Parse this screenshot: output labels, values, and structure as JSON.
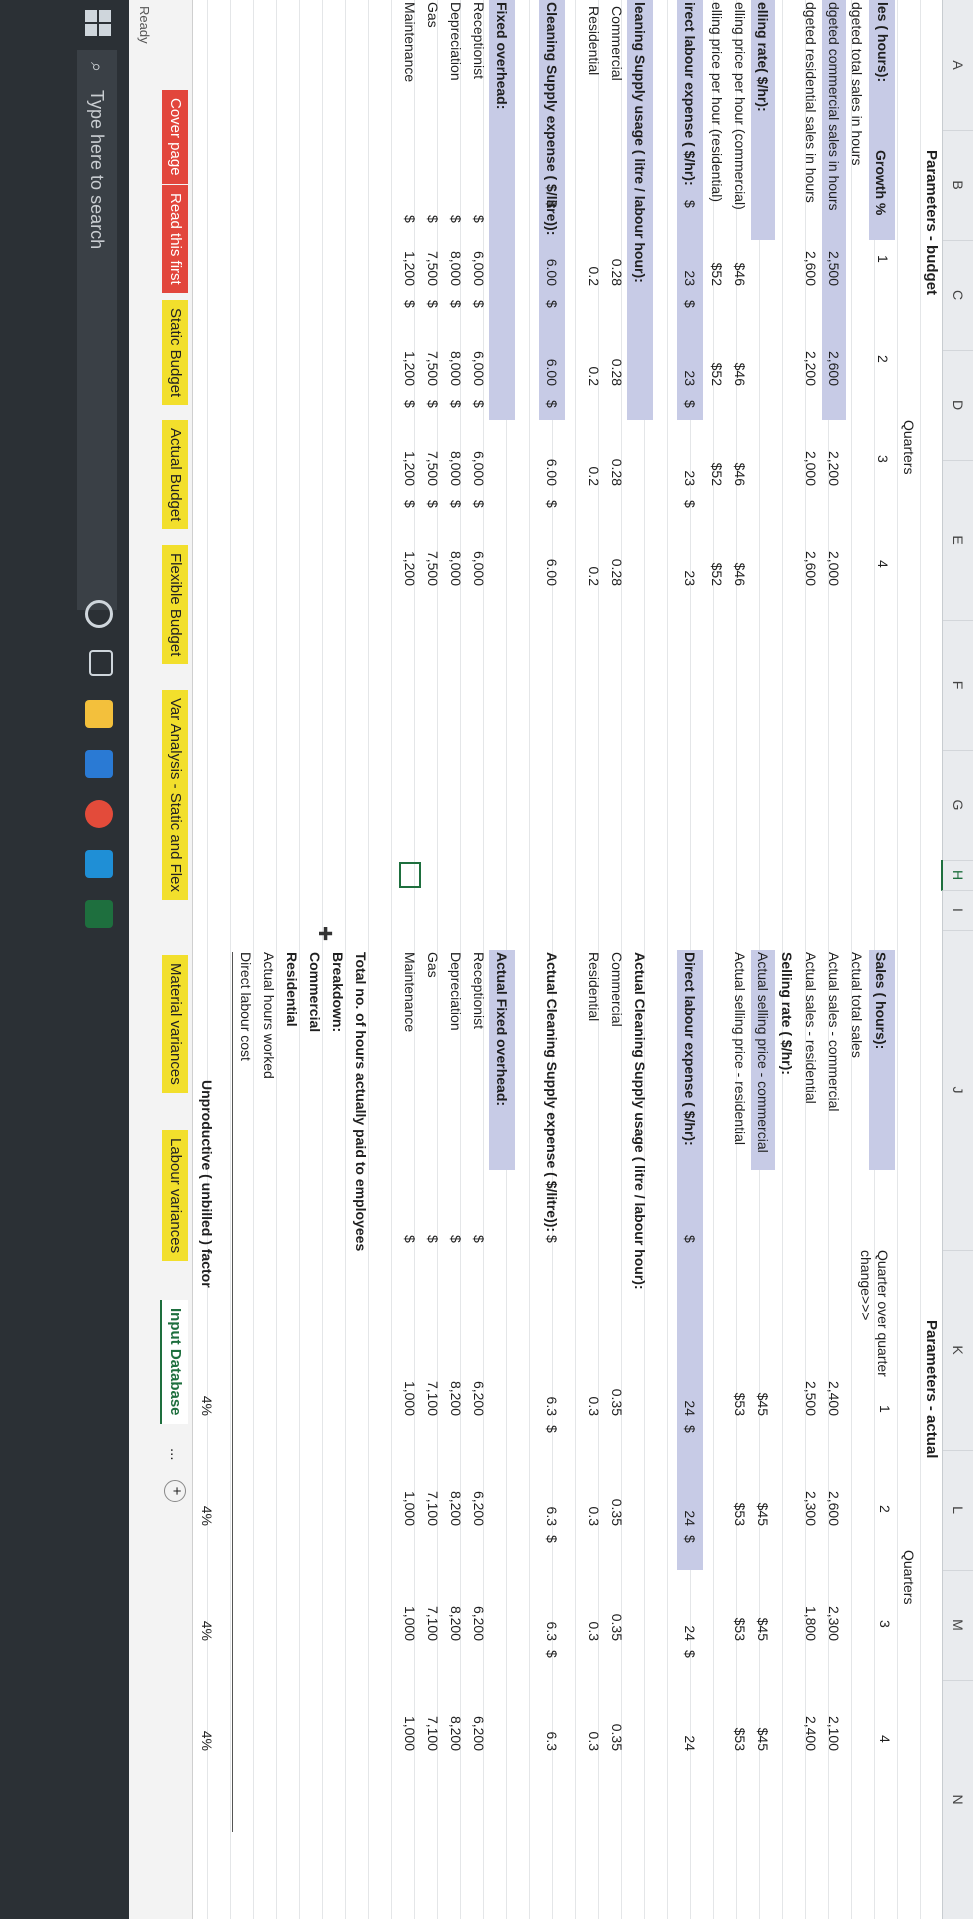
{
  "columns": [
    "A",
    "B",
    "C",
    "D",
    "E",
    "F",
    "G",
    "H",
    "I",
    "J",
    "K",
    "L",
    "M",
    "N"
  ],
  "budget": {
    "title": "Parameters - budget",
    "quarters_label": "Quarters",
    "quarters": [
      "1",
      "2",
      "3",
      "4"
    ],
    "growth_label": "Growth %",
    "rows": {
      "sales": "les ( hours):",
      "total": "dgeted total sales in hours",
      "comm": "dgeted commercial sales in hours",
      "res": "dgeted residential sales in hours",
      "rate": "elling rate( $/hr):",
      "rate_c": "elling price per hour (commercial)",
      "rate_r": "elling price per hour (residential)",
      "dl": "irect labour expense ( $/hr):",
      "csu": "leaning Supply usage ( litre / labour hour):",
      "csu_c": "Commercial",
      "csu_r": "Residential",
      "cse": "Cleaning Supply expense ( $/litre)):",
      "fo": "Fixed overhead:",
      "fo1": "Receptionist",
      "fo2": "Depreciation",
      "fo3": "Gas",
      "fo4": "Maintenance"
    },
    "comm": [
      "2,500",
      "2,600",
      "2,200",
      "2,000"
    ],
    "res": [
      "2,600",
      "2,200",
      "2,000",
      "2,600"
    ],
    "rate_c": [
      "$46",
      "$46",
      "$46",
      "$46"
    ],
    "rate_r": [
      "$52",
      "$52",
      "$52",
      "$52"
    ],
    "dl_cur": "$",
    "dl": [
      "23",
      "23",
      "23",
      "23"
    ],
    "csu_c": [
      "0.28",
      "0.28",
      "0.28",
      "0.28"
    ],
    "csu_r": [
      "0.2",
      "0.2",
      "0.2",
      "0.2"
    ],
    "cse": [
      "6.00",
      "6.00",
      "6.00",
      "6.00"
    ],
    "fo1": [
      "6,000",
      "6,000",
      "6,000",
      "6,000"
    ],
    "fo2": [
      "8,000",
      "8,000",
      "8,000",
      "8,000"
    ],
    "fo3": [
      "7,500",
      "7,500",
      "7,500",
      "7,500"
    ],
    "fo4": [
      "1,200",
      "1,200",
      "1,200",
      "1,200"
    ]
  },
  "actual": {
    "title": "Parameters - actual",
    "quarters_label": "Quarters",
    "quarters": [
      "1",
      "2",
      "3",
      "4"
    ],
    "change_label": "Quarter over quarter change>>>",
    "rows": {
      "sales": "Sales ( hours):",
      "total": "Actual total sales",
      "comm": "Actual sales - commercial",
      "res": "Actual sales - residential",
      "rate": "Selling rate ( $/hr):",
      "rate_c": "Actual selling price - commercial",
      "rate_r": "Actual selling price - residential",
      "dl": "Direct labour expense ( $/hr):",
      "csu": "Actual Cleaning Supply usage ( litre / labour hour):",
      "csu_c": "Commercial",
      "csu_r": "Residential",
      "cse": "Actual Cleaning Supply expense ( $/litre)):",
      "fo": "Actual Fixed overhead:",
      "fo1": "Receptionist",
      "fo2": "Depreciation",
      "fo3": "Gas",
      "fo4": "Maintenance",
      "paid": "Total no. of hours actually paid to employees",
      "bd": "Breakdown:",
      "bd_c": "Commercial",
      "bd_r": "Residential",
      "ahw": "Actual hours worked",
      "dlc": "Direct labour cost",
      "unp": "Unproductive ( unbilled ) factor"
    },
    "comm": [
      "2,400",
      "2,600",
      "2,300",
      "2,100"
    ],
    "res": [
      "2,500",
      "2,300",
      "1,800",
      "2,400"
    ],
    "rate_c": [
      "$45",
      "$45",
      "$45",
      "$45"
    ],
    "rate_r": [
      "$53",
      "$53",
      "$53",
      "$53"
    ],
    "dl": [
      "24",
      "24",
      "24",
      "24"
    ],
    "csu_c": [
      "0.35",
      "0.35",
      "0.35",
      "0.35"
    ],
    "csu_r": [
      "0.3",
      "0.3",
      "0.3",
      "0.3"
    ],
    "cse": [
      "6.3",
      "6.3",
      "6.3",
      "6.3"
    ],
    "fo1": [
      "6,200",
      "6,200",
      "6,200",
      "6,200"
    ],
    "fo2": [
      "8,200",
      "8,200",
      "8,200",
      "8,200"
    ],
    "fo3": [
      "7,100",
      "7,100",
      "7,100",
      "7,100"
    ],
    "fo4": [
      "1,000",
      "1,000",
      "1,000",
      "1,000"
    ],
    "unp": [
      "4%",
      "4%",
      "4%",
      "4%"
    ]
  },
  "currency": "$",
  "tabs": [
    "Cover page",
    "Read this first",
    "Static Budget",
    "Actual Budget",
    "Flexible Budget",
    "Var Analysis - Static and Flex",
    "Material variances",
    "Labour variances",
    "Input Database"
  ],
  "more_tabs": "...",
  "add_sheet": "+",
  "status": "Ready",
  "search_placeholder": "Type here to search",
  "colors": {
    "band": "#c7cbe6",
    "tab_red": "#e2463c",
    "tab_yellow": "#f2df2c",
    "excel_green": "#1e6f3e"
  }
}
